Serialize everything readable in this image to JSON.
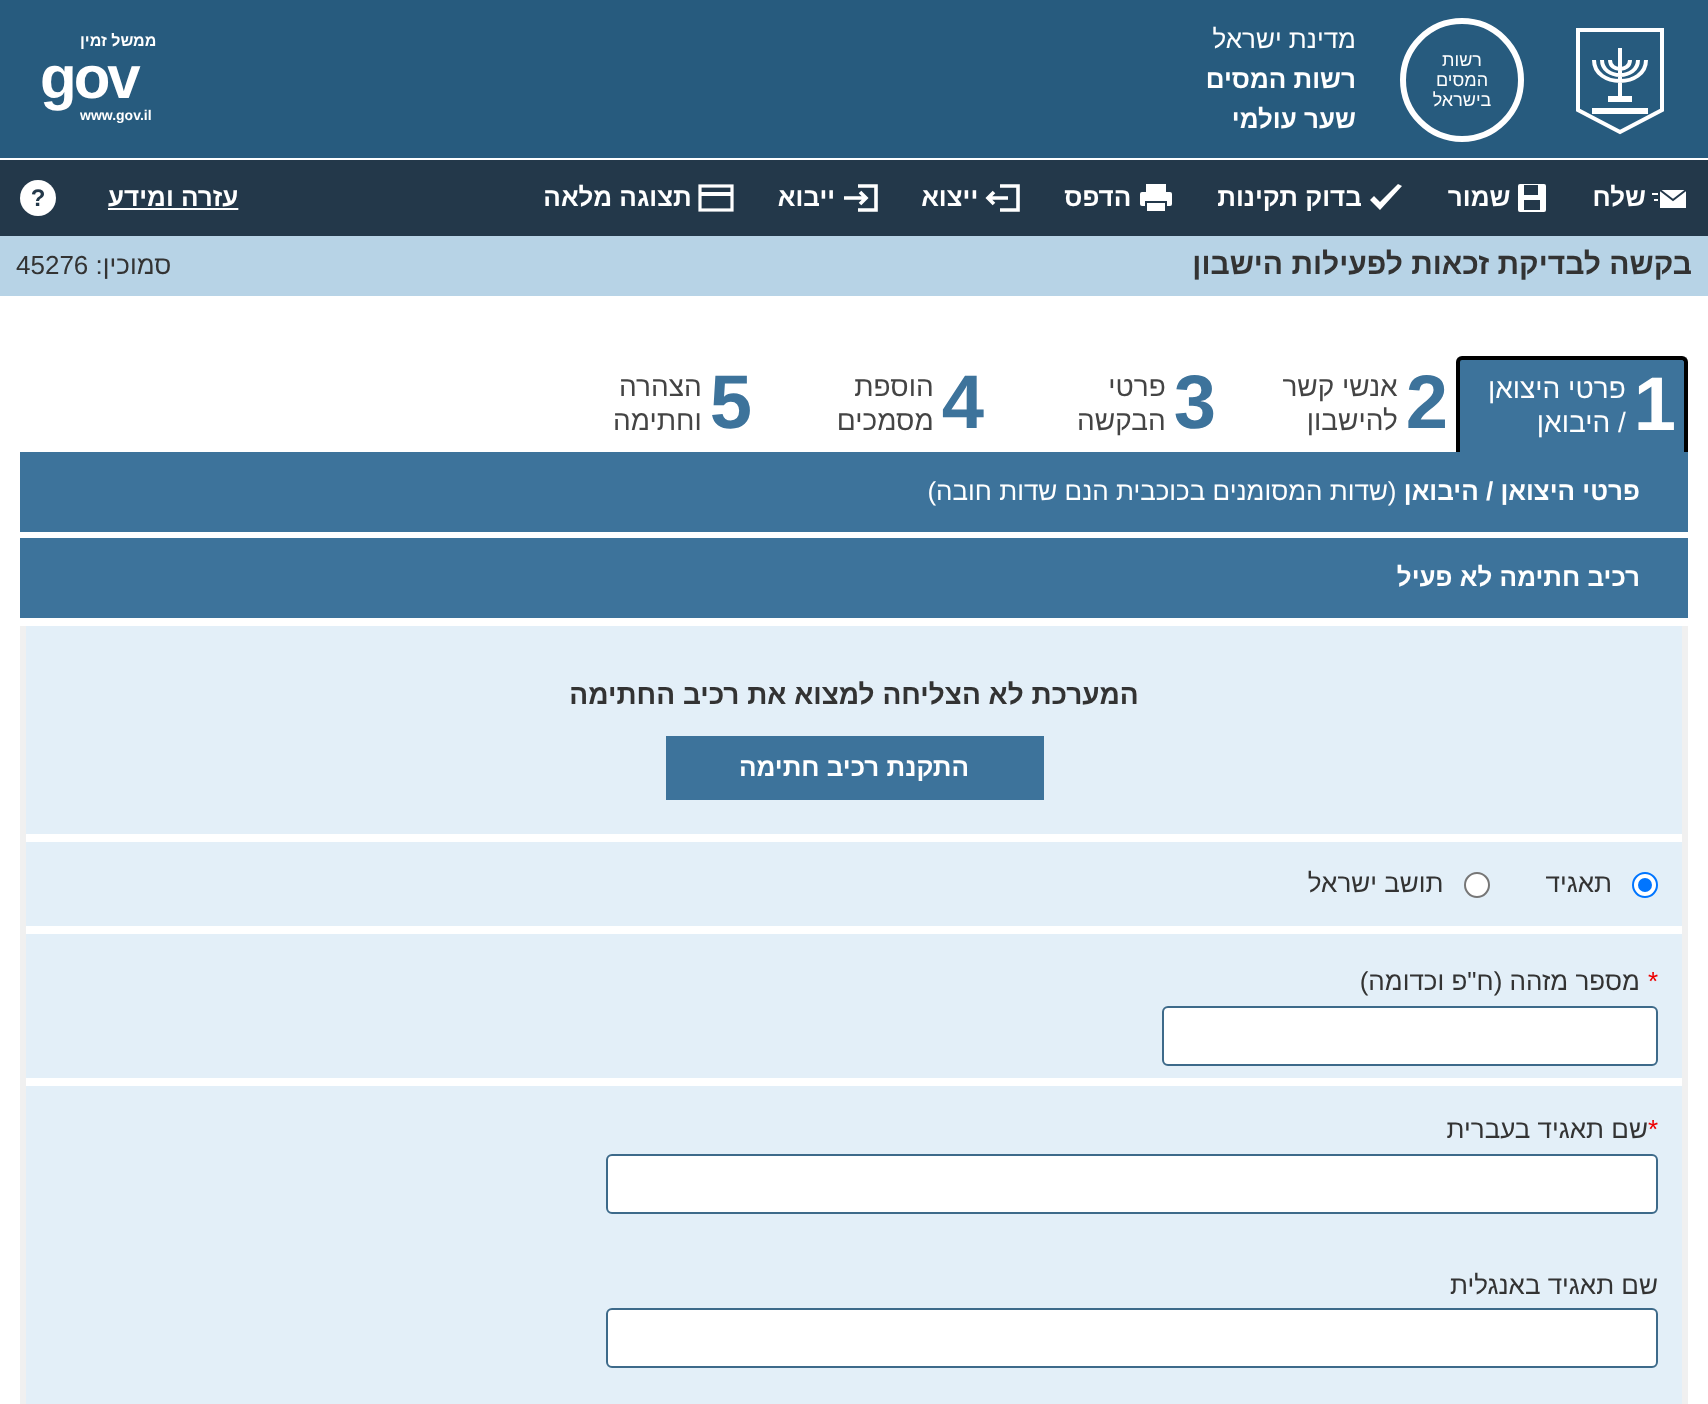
{
  "header": {
    "state": "מדינת ישראל",
    "authority": "רשות המסים",
    "portal": "שער עולמי",
    "tax_logo": [
      "רשות",
      "המסים",
      "בישראל"
    ],
    "gov_logo": {
      "tagline": "ממשל זמין",
      "word": "gov",
      "url": "www.gov.il"
    }
  },
  "toolbar": [
    {
      "label": "שלח",
      "kind": "send"
    },
    {
      "label": "שמור",
      "kind": "save"
    },
    {
      "label": "בדוק תקינות",
      "kind": "check"
    },
    {
      "label": "הדפס",
      "kind": "print"
    },
    {
      "label": "ייצוא",
      "kind": "export"
    },
    {
      "label": "ייבוא",
      "kind": "import"
    },
    {
      "label": "תצוגה מלאה",
      "kind": "fullscreen"
    }
  ],
  "help": {
    "label": "עזרה ומידע",
    "icon": "?"
  },
  "page_title": "בקשה לבדיקת זכאות לפעילות הישבון",
  "form_code": "סמוכין: 45276",
  "steps": [
    {
      "number": "1",
      "label": "פרטי היצואן / היבואן",
      "selected": true
    },
    {
      "number": "2",
      "label": "אנשי קשר להישבון",
      "selected": false
    },
    {
      "number": "3",
      "label": "פרטי הבקשה",
      "selected": false
    },
    {
      "number": "4",
      "label": "הוספת מסמכים",
      "selected": false
    },
    {
      "number": "5",
      "label": "הצהרה וחתימה",
      "selected": false
    }
  ],
  "section": {
    "title": "פרטי היצואן / היבואן",
    "note": "(שדות המסומנים בכוכבית הנם שדות חובה)"
  },
  "signature": {
    "title": "רכיב חתימה לא פעיל",
    "message": "המערכת לא הצליחה למצוא את רכיב החתימה",
    "button": "התקנת רכיב חתימה"
  },
  "entity_type": [
    {
      "label": "תאגיד",
      "selected": true
    },
    {
      "label": "תושב ישראל",
      "selected": false
    }
  ],
  "id_field": {
    "label": "מספר מזהה (ח\"פ וכדומה)",
    "required_mark": "*"
  },
  "name_fields": [
    {
      "label": "שם תאגיד בעברית",
      "required_mark": "*"
    },
    {
      "label": "שם תאגיד באנגלית"
    }
  ]
}
